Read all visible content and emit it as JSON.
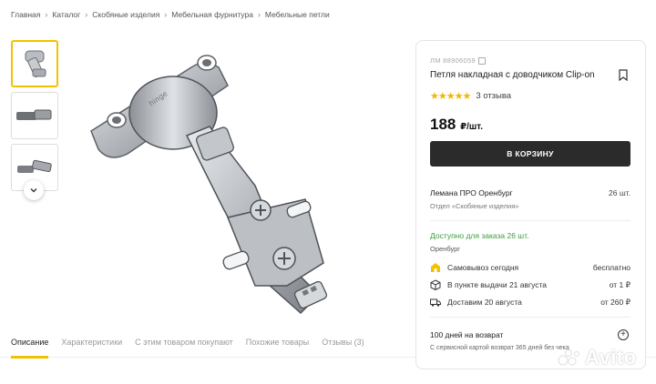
{
  "breadcrumb": [
    "Главная",
    "Каталог",
    "Скобяные изделия",
    "Мебельная фурнитура",
    "Мебельные петли"
  ],
  "breadcrumb_separator": "›",
  "thumbnails": [
    {
      "icon": "hinge-front-thumbnail"
    },
    {
      "icon": "hinge-side-thumbnail"
    },
    {
      "icon": "hinge-open-thumbnail"
    }
  ],
  "tabs": [
    "Описание",
    "Характеристики",
    "С этим товаром покупают",
    "Похожие товары",
    "Отзывы (3)"
  ],
  "product": {
    "sku": "ЛМ 88906059",
    "title": "Петля накладная с доводчиком Clip-on",
    "stars": "★★★★★",
    "reviews": "3 отзыва",
    "price": "188",
    "price_unit": "₽/шт.",
    "cart_button": "В КОРЗИНУ"
  },
  "store": {
    "name": "Лемана ПРО Оренбург",
    "qty": "26 шт.",
    "department": "Отдел «Скобяные изделия»"
  },
  "availability": {
    "text": "Доступно для заказа 26 шт.",
    "city": "Оренбург"
  },
  "delivery": [
    {
      "icon": "pickup-today-icon",
      "label": "Самовывоз сегодня",
      "price": "бесплатно"
    },
    {
      "icon": "parcel-box-icon",
      "label": "В пункте выдачи 21 августа",
      "price": "от 1 ₽"
    },
    {
      "icon": "truck-icon",
      "label": "Доставим 20 августа",
      "price": "от 260 ₽"
    }
  ],
  "return": {
    "title": "100 дней на возврат",
    "subtitle": "С сервисной картой возврат 365 дней без чека"
  },
  "watermark": "Avito",
  "colors": {
    "accent": "#f2c200",
    "button": "#2b2b2b",
    "available": "#3a9c3a",
    "stars": "#f2b600"
  }
}
